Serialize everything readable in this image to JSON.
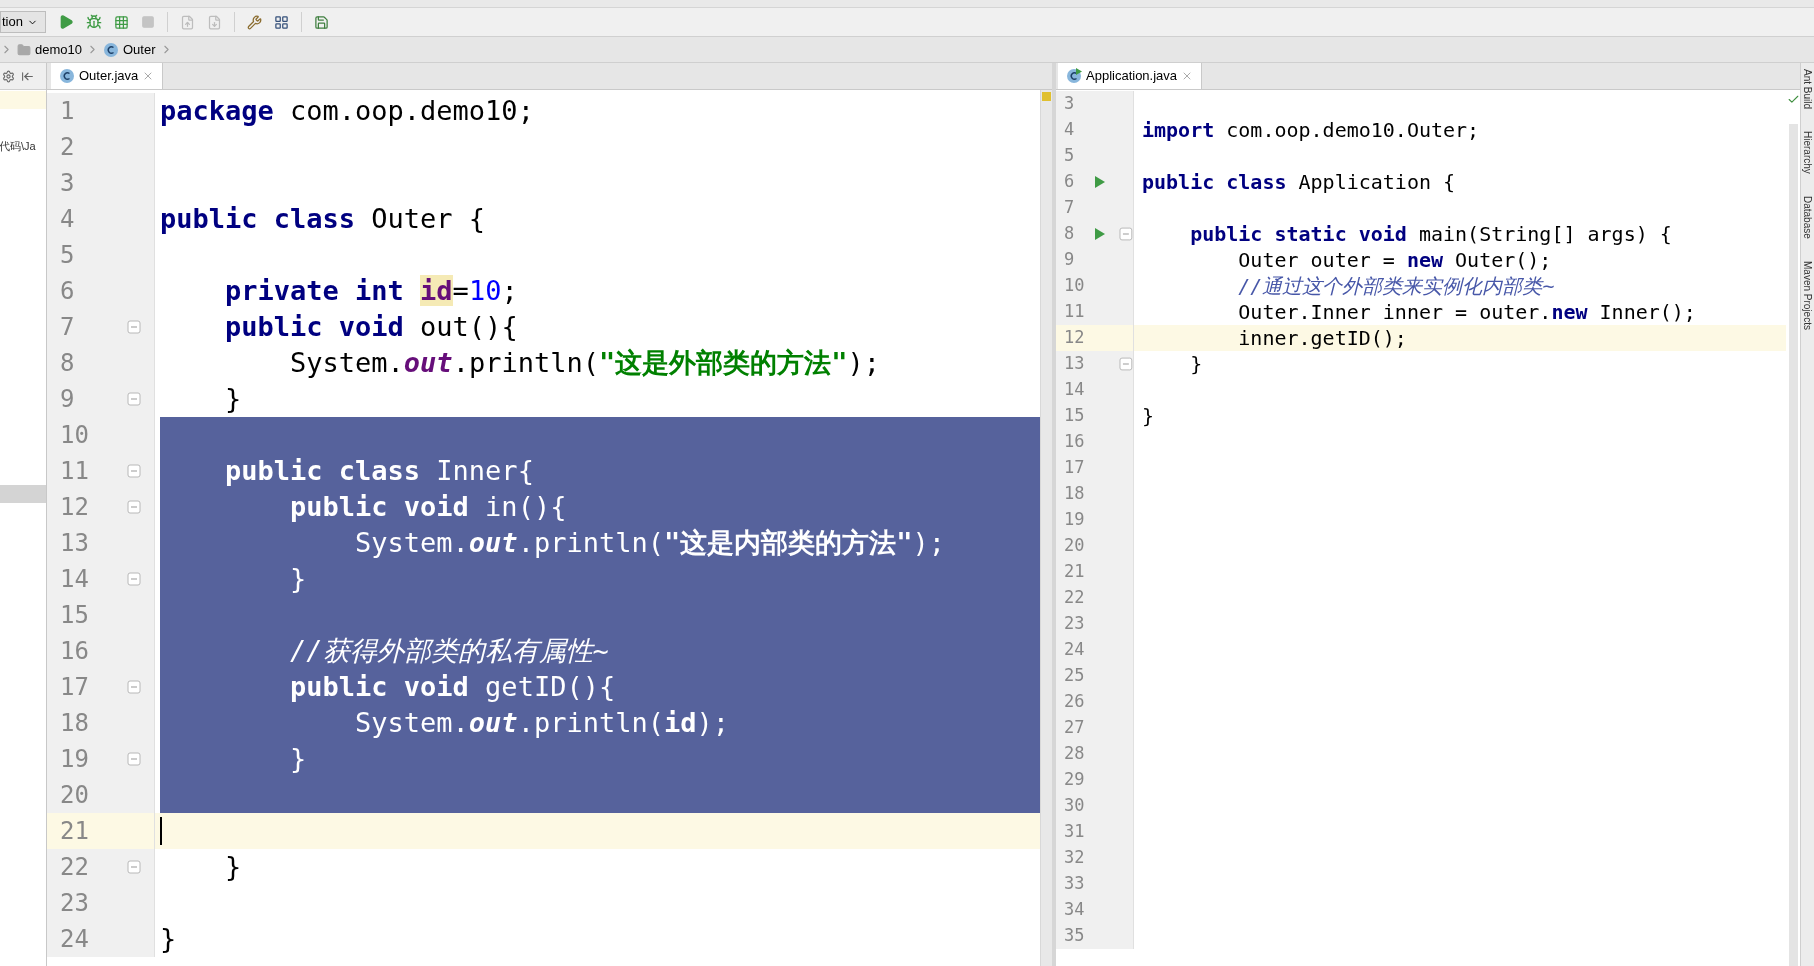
{
  "toolbar": {
    "run_config": "tion"
  },
  "breadcrumb": [
    {
      "kind": "folder",
      "label": "demo10"
    },
    {
      "kind": "class",
      "label": "Outer"
    }
  ],
  "project_panel": {
    "rows": [
      {
        "kind": "current"
      },
      {
        "kind": "text",
        "text": "代码\\Ja"
      },
      {
        "kind": "selected"
      }
    ]
  },
  "left_editor": {
    "tab": {
      "title": "Outer.java",
      "selected": true
    },
    "lines": [
      {
        "number": "1",
        "selected": false,
        "current": false,
        "fold": false,
        "tokens": [
          {
            "kind": "keyword",
            "text": "package"
          },
          {
            "kind": "plain",
            "text": " com.oop.demo10;"
          }
        ]
      },
      {
        "number": "2",
        "selected": false,
        "current": false,
        "fold": false
      },
      {
        "number": "3",
        "selected": false,
        "current": false,
        "fold": false
      },
      {
        "number": "4",
        "selected": false,
        "current": false,
        "fold": false,
        "tokens": [
          {
            "kind": "keyword",
            "text": "public class"
          },
          {
            "kind": "plain",
            "text": " Outer {"
          }
        ]
      },
      {
        "number": "5",
        "selected": false,
        "current": false,
        "fold": false
      },
      {
        "number": "6",
        "selected": false,
        "current": false,
        "fold": false,
        "tokens": [
          {
            "kind": "keyword",
            "text": "    private int "
          },
          {
            "kind": "highlight",
            "text": "id"
          },
          {
            "kind": "plain",
            "text": "="
          },
          {
            "kind": "number",
            "text": "10"
          },
          {
            "kind": "plain",
            "text": ";"
          }
        ]
      },
      {
        "number": "7",
        "selected": false,
        "current": false,
        "fold": true,
        "tokens": [
          {
            "kind": "keyword",
            "text": "    public void"
          },
          {
            "kind": "plain",
            "text": " out(){"
          }
        ]
      },
      {
        "number": "8",
        "selected": false,
        "current": false,
        "fold": false,
        "tokens": [
          {
            "kind": "plain",
            "text": "        System."
          },
          {
            "kind": "static",
            "text": "out"
          },
          {
            "kind": "plain",
            "text": ".println("
          },
          {
            "kind": "string",
            "text": "\"这是外部类的方法\""
          },
          {
            "kind": "plain",
            "text": ");"
          }
        ]
      },
      {
        "number": "9",
        "selected": false,
        "current": false,
        "fold": true,
        "tokens": [
          {
            "kind": "plain",
            "text": "    }"
          }
        ]
      },
      {
        "number": "10",
        "selected": true,
        "current": false,
        "fold": false
      },
      {
        "number": "11",
        "selected": true,
        "current": false,
        "fold": true,
        "tokens": [
          {
            "kind": "keyword",
            "text": "    public class"
          },
          {
            "kind": "plain",
            "text": " Inner{"
          }
        ]
      },
      {
        "number": "12",
        "selected": true,
        "current": false,
        "fold": true,
        "tokens": [
          {
            "kind": "keyword",
            "text": "        public void"
          },
          {
            "kind": "plain",
            "text": " in(){"
          }
        ]
      },
      {
        "number": "13",
        "selected": true,
        "current": false,
        "fold": false,
        "tokens": [
          {
            "kind": "plain",
            "text": "            System."
          },
          {
            "kind": "static",
            "text": "out"
          },
          {
            "kind": "plain",
            "text": ".println("
          },
          {
            "kind": "string",
            "text": "\"这是内部类的方法\""
          },
          {
            "kind": "plain",
            "text": ");"
          }
        ]
      },
      {
        "number": "14",
        "selected": true,
        "current": false,
        "fold": true,
        "tokens": [
          {
            "kind": "plain",
            "text": "        }"
          }
        ]
      },
      {
        "number": "15",
        "selected": true,
        "current": false,
        "fold": false
      },
      {
        "number": "16",
        "selected": true,
        "current": false,
        "fold": false,
        "tokens": [
          {
            "kind": "comment",
            "text": "        //获得外部类的私有属性~"
          }
        ]
      },
      {
        "number": "17",
        "selected": true,
        "current": false,
        "fold": true,
        "tokens": [
          {
            "kind": "keyword",
            "text": "        public void"
          },
          {
            "kind": "plain",
            "text": " getID(){"
          }
        ]
      },
      {
        "number": "18",
        "selected": true,
        "current": false,
        "fold": false,
        "tokens": [
          {
            "kind": "plain",
            "text": "            System."
          },
          {
            "kind": "static",
            "text": "out"
          },
          {
            "kind": "plain",
            "text": ".println("
          },
          {
            "kind": "field",
            "text": "id"
          },
          {
            "kind": "plain",
            "text": ");"
          }
        ]
      },
      {
        "number": "19",
        "selected": true,
        "current": false,
        "fold": true,
        "tokens": [
          {
            "kind": "plain",
            "text": "        }"
          }
        ]
      },
      {
        "number": "20",
        "selected": true,
        "current": false,
        "fold": false
      },
      {
        "number": "21",
        "selected": false,
        "current": true,
        "fold": false
      },
      {
        "number": "22",
        "selected": false,
        "current": false,
        "fold": true,
        "tokens": [
          {
            "kind": "plain",
            "text": "    }"
          }
        ]
      },
      {
        "number": "23",
        "selected": false,
        "current": false,
        "fold": false
      },
      {
        "number": "24",
        "selected": false,
        "current": false,
        "fold": false,
        "tokens": [
          {
            "kind": "plain",
            "text": "}"
          }
        ]
      }
    ]
  },
  "right_editor": {
    "tab": {
      "title": "Application.java",
      "selected": true
    },
    "lines": [
      {
        "number": "3",
        "current": false,
        "run": false,
        "fold": false
      },
      {
        "number": "4",
        "current": false,
        "run": false,
        "fold": false,
        "tokens": [
          {
            "kind": "keyword",
            "text": "import"
          },
          {
            "kind": "plain",
            "text": " com.oop.demo10.Outer;"
          }
        ]
      },
      {
        "number": "5",
        "current": false,
        "run": false,
        "fold": false
      },
      {
        "number": "6",
        "current": false,
        "run": true,
        "fold": false,
        "tokens": [
          {
            "kind": "keyword",
            "text": "public class"
          },
          {
            "kind": "plain",
            "text": " Application {"
          }
        ]
      },
      {
        "number": "7",
        "current": false,
        "run": false,
        "fold": false
      },
      {
        "number": "8",
        "current": false,
        "run": true,
        "fold": true,
        "tokens": [
          {
            "kind": "keyword",
            "text": "    public static void"
          },
          {
            "kind": "plain",
            "text": " main(String[] args) {"
          }
        ]
      },
      {
        "number": "9",
        "current": false,
        "run": false,
        "fold": false,
        "tokens": [
          {
            "kind": "plain",
            "text": "        Outer outer = "
          },
          {
            "kind": "keyword",
            "text": "new"
          },
          {
            "kind": "plain",
            "text": " Outer();"
          }
        ]
      },
      {
        "number": "10",
        "current": false,
        "run": false,
        "fold": false,
        "tokens": [
          {
            "kind": "comment",
            "text": "        //通过这个外部类来实例化内部类~"
          }
        ]
      },
      {
        "number": "11",
        "current": false,
        "run": false,
        "fold": false,
        "tokens": [
          {
            "kind": "plain",
            "text": "        Outer.Inner inner = outer."
          },
          {
            "kind": "keyword",
            "text": "new"
          },
          {
            "kind": "plain",
            "text": " Inner();"
          }
        ]
      },
      {
        "number": "12",
        "current": true,
        "run": false,
        "fold": false,
        "tokens": [
          {
            "kind": "plain",
            "text": "        inner.getID();"
          }
        ]
      },
      {
        "number": "13",
        "current": false,
        "run": false,
        "fold": true,
        "tokens": [
          {
            "kind": "plain",
            "text": "    }"
          }
        ]
      },
      {
        "number": "14",
        "current": false,
        "run": false,
        "fold": false
      },
      {
        "number": "15",
        "current": false,
        "run": false,
        "fold": false,
        "tokens": [
          {
            "kind": "plain",
            "text": "}"
          }
        ]
      },
      {
        "number": "16",
        "current": false,
        "run": false,
        "fold": false
      },
      {
        "number": "17",
        "current": false,
        "run": false,
        "fold": false
      },
      {
        "number": "18",
        "current": false,
        "run": false,
        "fold": false
      },
      {
        "number": "19",
        "current": false,
        "run": false,
        "fold": false
      },
      {
        "number": "20",
        "current": false,
        "run": false,
        "fold": false
      },
      {
        "number": "21",
        "current": false,
        "run": false,
        "fold": false
      },
      {
        "number": "22",
        "current": false,
        "run": false,
        "fold": false
      },
      {
        "number": "23",
        "current": false,
        "run": false,
        "fold": false
      },
      {
        "number": "24",
        "current": false,
        "run": false,
        "fold": false
      },
      {
        "number": "25",
        "current": false,
        "run": false,
        "fold": false
      },
      {
        "number": "26",
        "current": false,
        "run": false,
        "fold": false
      },
      {
        "number": "27",
        "current": false,
        "run": false,
        "fold": false
      },
      {
        "number": "28",
        "current": false,
        "run": false,
        "fold": false
      },
      {
        "number": "29",
        "current": false,
        "run": false,
        "fold": false
      },
      {
        "number": "30",
        "current": false,
        "run": false,
        "fold": false
      },
      {
        "number": "31",
        "current": false,
        "run": false,
        "fold": false
      },
      {
        "number": "32",
        "current": false,
        "run": false,
        "fold": false
      },
      {
        "number": "33",
        "current": false,
        "run": false,
        "fold": false
      },
      {
        "number": "34",
        "current": false,
        "run": false,
        "fold": false
      },
      {
        "number": "35",
        "current": false,
        "run": false,
        "fold": false
      }
    ]
  },
  "tool_strip": [
    {
      "label": "Ant Build"
    },
    {
      "label": "Hierarchy"
    },
    {
      "label": "Database"
    },
    {
      "label": "Maven Projects"
    }
  ]
}
